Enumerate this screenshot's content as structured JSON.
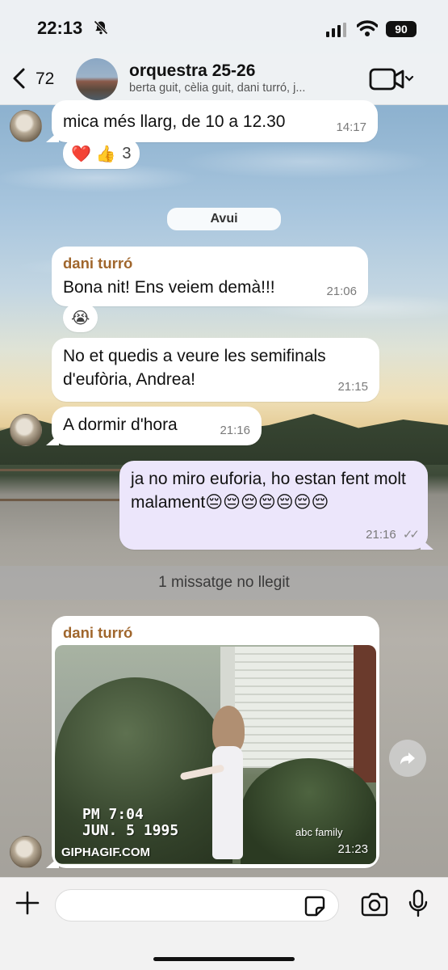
{
  "status_bar": {
    "time": "22:13",
    "battery": "90"
  },
  "header": {
    "back_count": "72",
    "group_name": "orquestra 25-26",
    "members": "berta guit, cèlia guit, dani turró, j..."
  },
  "messages": [
    {
      "id": "m0",
      "direction": "in",
      "text": "mica més llarg, de 10 a 12.30",
      "time": "14:17",
      "reactions": {
        "emojis": "❤️ 👍",
        "count": "3"
      }
    },
    {
      "id": "date",
      "type": "date",
      "text": "Avui"
    },
    {
      "id": "m1",
      "direction": "in",
      "sender": "dani turró",
      "text": "Bona nit! Ens veiem demà!!!",
      "time": "21:06",
      "reaction": "😭"
    },
    {
      "id": "m2",
      "direction": "in",
      "text": "No et quedis a veure les semifinals d'eufòria, Andrea!",
      "time": "21:15"
    },
    {
      "id": "m3",
      "direction": "in",
      "text": "A dormir d'hora",
      "time": "21:16"
    },
    {
      "id": "m4",
      "direction": "out",
      "text": "ja no miro euforia, ho estan fent molt malament😔😔😔😔😔😔😔",
      "time": "21:16",
      "read": "✓✓"
    },
    {
      "id": "unread",
      "type": "divider",
      "text": "1 missatge no llegit"
    },
    {
      "id": "m5",
      "direction": "in",
      "sender": "dani turró",
      "type": "gif",
      "time": "21:23",
      "gif_text": {
        "stamp_line1": "PM 7:04",
        "stamp_line2": "JUN. 5 1995",
        "watermark": "GIPHAGIF.COM",
        "channel": "abc family"
      }
    }
  ],
  "composer": {
    "value": "",
    "placeholder": ""
  },
  "icons": [
    "chevron-left-icon",
    "video-camera-icon",
    "forward-icon",
    "plus-icon",
    "sticker-icon",
    "camera-icon",
    "microphone-icon",
    "bell-slash-icon",
    "wifi-icon",
    "signal-icon"
  ]
}
